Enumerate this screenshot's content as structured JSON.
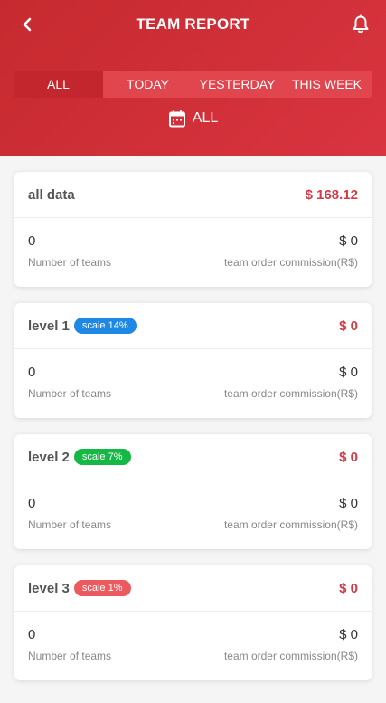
{
  "header": {
    "title": "TEAM REPORT",
    "back_icon": "chevron-left-icon",
    "bell_icon": "bell-icon",
    "tabs": [
      "ALL",
      "TODAY",
      "YESTERDAY",
      "THIS WEEK"
    ],
    "active_tab": "ALL",
    "date_filter": {
      "icon": "calendar-icon",
      "label": "ALL"
    }
  },
  "cards": [
    {
      "title": "all data",
      "amount": "$ 168.12",
      "left_value": "0",
      "left_label": "Number of teams",
      "right_value": "$ 0",
      "right_label": "team order commission(R$)"
    },
    {
      "title": "level 1",
      "badge": "scale 14%",
      "badge_color": "#1e88e5",
      "amount": "$ 0",
      "left_value": "0",
      "left_label": "Number of teams",
      "right_value": "$ 0",
      "right_label": "team order commission(R$)"
    },
    {
      "title": "level 2",
      "badge": "scale 7%",
      "badge_color": "#13b845",
      "amount": "$ 0",
      "left_value": "0",
      "left_label": "Number of teams",
      "right_value": "$ 0",
      "right_label": "team order commission(R$)"
    },
    {
      "title": "level 3",
      "badge": "scale 1%",
      "badge_color": "#ec5a5f",
      "amount": "$ 0",
      "left_value": "0",
      "left_label": "Number of teams",
      "right_value": "$ 0",
      "right_label": "team order commission(R$)"
    }
  ],
  "colors": {
    "header_red": "#d0303a",
    "active_tab": "#c4262d",
    "tab_bar": "#e1454e",
    "amount_red": "#d23a44"
  }
}
